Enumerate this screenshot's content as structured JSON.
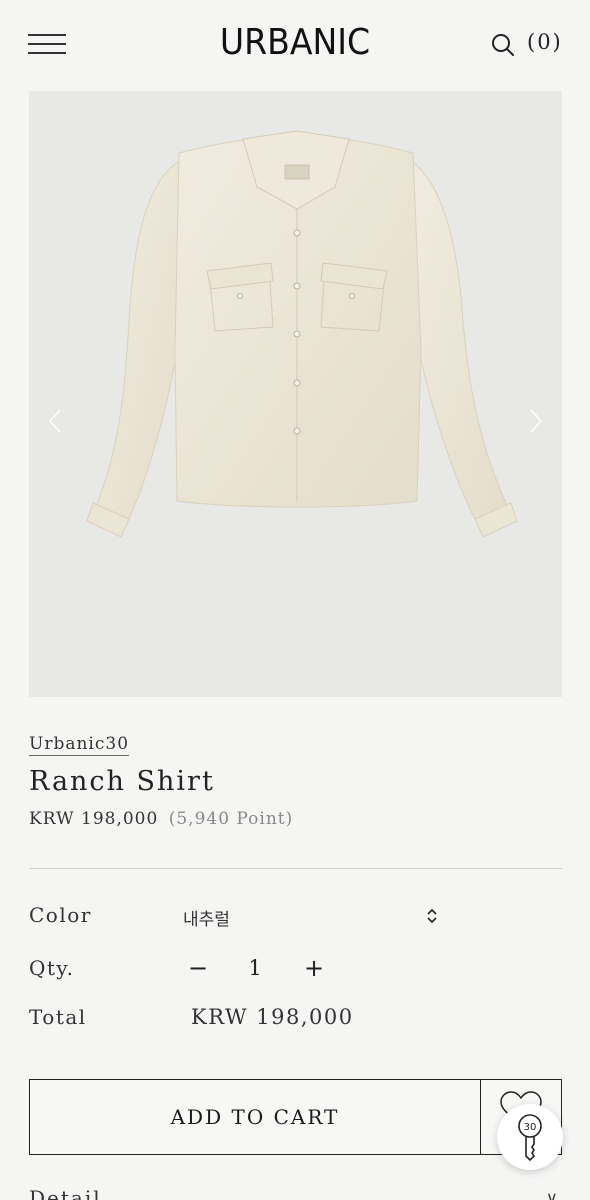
{
  "header": {
    "logo": "URBANIC",
    "cart_label": "(0)"
  },
  "product": {
    "brand": "Urbanic30",
    "title": "Ranch Shirt",
    "price": "KRW 198,000",
    "points": "(5,940 Point)"
  },
  "options": {
    "color_label": "Color",
    "color_value": "내추럴",
    "qty_label": "Qty.",
    "qty_minus": "−",
    "qty_value": "1",
    "qty_plus": "+",
    "total_label": "Total",
    "total_value": "KRW 198,000"
  },
  "actions": {
    "add_to_cart": "ADD TO CART",
    "badge_number": "30"
  },
  "detail": {
    "label": "Detail",
    "toggle": "∨"
  },
  "colors": {
    "background": "#f5f5f4",
    "gallery_bg": "#e8e8e6",
    "shirt": "#ece6d6"
  }
}
